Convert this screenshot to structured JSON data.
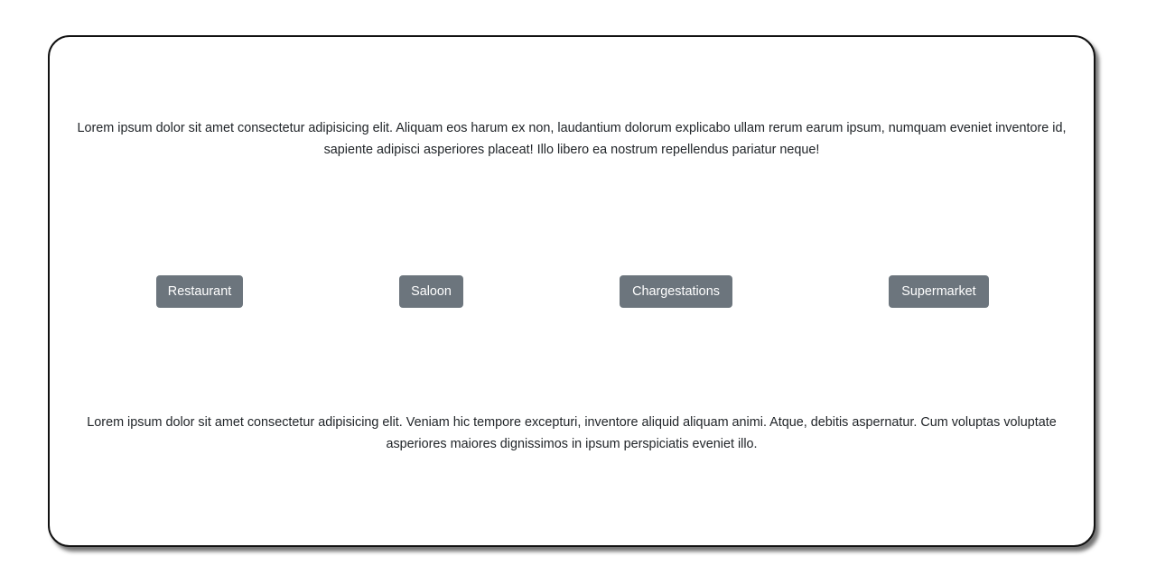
{
  "content": {
    "top_paragraph": "Lorem ipsum dolor sit amet consectetur adipisicing elit. Aliquam eos harum ex non, laudantium dolorum explicabo ullam rerum earum ipsum, numquam eveniet inventore id, sapiente adipisci asperiores placeat! Illo libero ea nostrum repellendus pariatur neque!",
    "bottom_paragraph": "Lorem ipsum dolor sit amet consectetur adipisicing elit. Veniam hic tempore excepturi, inventore aliquid aliquam animi. Atque, debitis aspernatur. Cum voluptas voluptate asperiores maiores dignissimos in ipsum perspiciatis eveniet illo."
  },
  "categories": [
    {
      "label": "Restaurant"
    },
    {
      "label": "Saloon"
    },
    {
      "label": "Chargestations"
    },
    {
      "label": "Supermarket"
    }
  ],
  "colors": {
    "button_background": "#6c757d",
    "button_text": "#ffffff",
    "text": "#212529",
    "card_border": "#111111"
  }
}
